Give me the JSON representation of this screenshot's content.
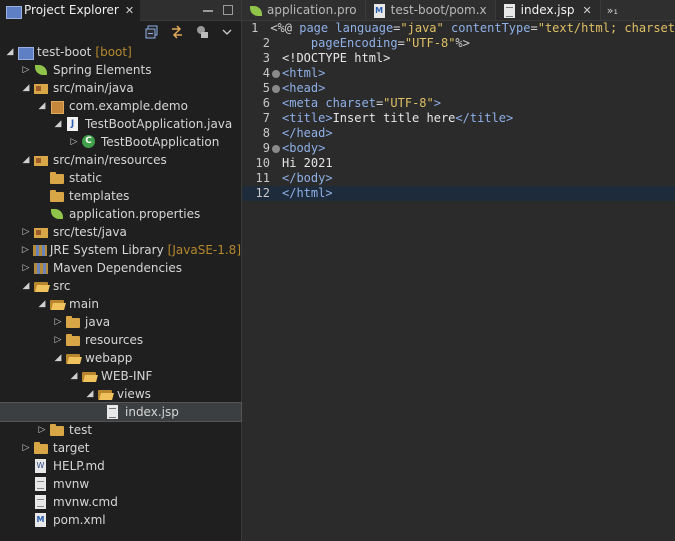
{
  "explorer": {
    "tab_label": "Project Explorer",
    "tab_close": "✕",
    "tree": [
      {
        "label": "test-boot",
        "decoration": "[boot]",
        "icon": "project-icon"
      },
      {
        "label": "Spring Elements",
        "icon": "spring-leaf-icon"
      },
      {
        "label": "src/main/java",
        "icon": "source-folder-icon"
      },
      {
        "label": "com.example.demo",
        "icon": "package-icon"
      },
      {
        "label": "TestBootApplication.java",
        "icon": "java-file-icon"
      },
      {
        "label": "TestBootApplication",
        "icon": "class-icon"
      },
      {
        "label": "src/main/resources",
        "icon": "source-folder-icon"
      },
      {
        "label": "static",
        "icon": "folder-icon"
      },
      {
        "label": "templates",
        "icon": "folder-icon"
      },
      {
        "label": "application.properties",
        "icon": "spring-leaf-icon"
      },
      {
        "label": "src/test/java",
        "icon": "source-folder-icon"
      },
      {
        "label": "JRE System Library",
        "decoration": "[JavaSE-1.8]",
        "icon": "library-icon"
      },
      {
        "label": "Maven Dependencies",
        "icon": "library-icon"
      },
      {
        "label": "src",
        "icon": "folder-icon"
      },
      {
        "label": "main",
        "icon": "folder-icon"
      },
      {
        "label": "java",
        "icon": "folder-icon"
      },
      {
        "label": "resources",
        "icon": "folder-icon"
      },
      {
        "label": "webapp",
        "icon": "folder-icon"
      },
      {
        "label": "WEB-INF",
        "icon": "folder-icon"
      },
      {
        "label": "views",
        "icon": "folder-icon"
      },
      {
        "label": "index.jsp",
        "icon": "jsp-file-icon"
      },
      {
        "label": "test",
        "icon": "folder-icon"
      },
      {
        "label": "target",
        "icon": "folder-icon"
      },
      {
        "label": "HELP.md",
        "icon": "markdown-file-icon"
      },
      {
        "label": "mvnw",
        "icon": "text-file-icon"
      },
      {
        "label": "mvnw.cmd",
        "icon": "text-file-icon"
      },
      {
        "label": "pom.xml",
        "icon": "maven-xml-icon"
      }
    ]
  },
  "editor": {
    "tabs": [
      {
        "label": "application.pro",
        "icon": "spring-leaf-icon"
      },
      {
        "label": "test-boot/pom.x",
        "icon": "maven-xml-icon"
      },
      {
        "label": "index.jsp",
        "icon": "jsp-file-icon",
        "active": true
      }
    ],
    "overflow_label": "»₁",
    "line_numbers": [
      "1",
      "2",
      "3",
      "4",
      "5",
      "6",
      "7",
      "8",
      "9",
      "10",
      "11",
      "12"
    ]
  },
  "colors": {
    "accent_current_line": "#1d2b3a",
    "string": "#e0c064",
    "tag": "#8fb0e8"
  }
}
